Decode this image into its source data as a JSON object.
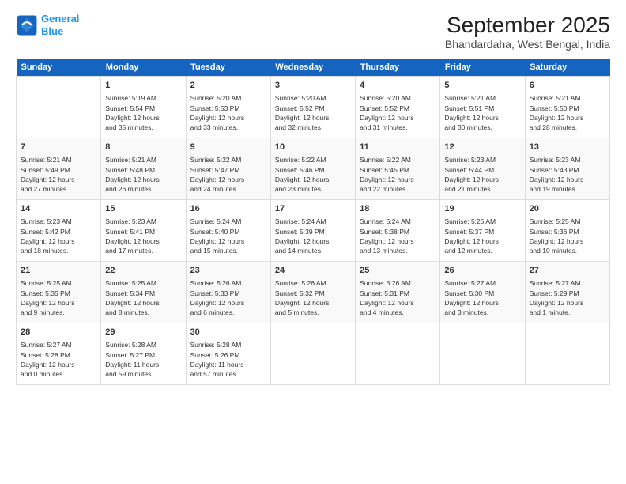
{
  "logo": {
    "line1": "General",
    "line2": "Blue"
  },
  "title": "September 2025",
  "subtitle": "Bhandardaha, West Bengal, India",
  "days_header": [
    "Sunday",
    "Monday",
    "Tuesday",
    "Wednesday",
    "Thursday",
    "Friday",
    "Saturday"
  ],
  "weeks": [
    [
      {
        "day": "",
        "text": ""
      },
      {
        "day": "1",
        "text": "Sunrise: 5:19 AM\nSunset: 5:54 PM\nDaylight: 12 hours\nand 35 minutes."
      },
      {
        "day": "2",
        "text": "Sunrise: 5:20 AM\nSunset: 5:53 PM\nDaylight: 12 hours\nand 33 minutes."
      },
      {
        "day": "3",
        "text": "Sunrise: 5:20 AM\nSunset: 5:52 PM\nDaylight: 12 hours\nand 32 minutes."
      },
      {
        "day": "4",
        "text": "Sunrise: 5:20 AM\nSunset: 5:52 PM\nDaylight: 12 hours\nand 31 minutes."
      },
      {
        "day": "5",
        "text": "Sunrise: 5:21 AM\nSunset: 5:51 PM\nDaylight: 12 hours\nand 30 minutes."
      },
      {
        "day": "6",
        "text": "Sunrise: 5:21 AM\nSunset: 5:50 PM\nDaylight: 12 hours\nand 28 minutes."
      }
    ],
    [
      {
        "day": "7",
        "text": "Sunrise: 5:21 AM\nSunset: 5:49 PM\nDaylight: 12 hours\nand 27 minutes."
      },
      {
        "day": "8",
        "text": "Sunrise: 5:21 AM\nSunset: 5:48 PM\nDaylight: 12 hours\nand 26 minutes."
      },
      {
        "day": "9",
        "text": "Sunrise: 5:22 AM\nSunset: 5:47 PM\nDaylight: 12 hours\nand 24 minutes."
      },
      {
        "day": "10",
        "text": "Sunrise: 5:22 AM\nSunset: 5:46 PM\nDaylight: 12 hours\nand 23 minutes."
      },
      {
        "day": "11",
        "text": "Sunrise: 5:22 AM\nSunset: 5:45 PM\nDaylight: 12 hours\nand 22 minutes."
      },
      {
        "day": "12",
        "text": "Sunrise: 5:23 AM\nSunset: 5:44 PM\nDaylight: 12 hours\nand 21 minutes."
      },
      {
        "day": "13",
        "text": "Sunrise: 5:23 AM\nSunset: 5:43 PM\nDaylight: 12 hours\nand 19 minutes."
      }
    ],
    [
      {
        "day": "14",
        "text": "Sunrise: 5:23 AM\nSunset: 5:42 PM\nDaylight: 12 hours\nand 18 minutes."
      },
      {
        "day": "15",
        "text": "Sunrise: 5:23 AM\nSunset: 5:41 PM\nDaylight: 12 hours\nand 17 minutes."
      },
      {
        "day": "16",
        "text": "Sunrise: 5:24 AM\nSunset: 5:40 PM\nDaylight: 12 hours\nand 15 minutes."
      },
      {
        "day": "17",
        "text": "Sunrise: 5:24 AM\nSunset: 5:39 PM\nDaylight: 12 hours\nand 14 minutes."
      },
      {
        "day": "18",
        "text": "Sunrise: 5:24 AM\nSunset: 5:38 PM\nDaylight: 12 hours\nand 13 minutes."
      },
      {
        "day": "19",
        "text": "Sunrise: 5:25 AM\nSunset: 5:37 PM\nDaylight: 12 hours\nand 12 minutes."
      },
      {
        "day": "20",
        "text": "Sunrise: 5:25 AM\nSunset: 5:36 PM\nDaylight: 12 hours\nand 10 minutes."
      }
    ],
    [
      {
        "day": "21",
        "text": "Sunrise: 5:25 AM\nSunset: 5:35 PM\nDaylight: 12 hours\nand 9 minutes."
      },
      {
        "day": "22",
        "text": "Sunrise: 5:25 AM\nSunset: 5:34 PM\nDaylight: 12 hours\nand 8 minutes."
      },
      {
        "day": "23",
        "text": "Sunrise: 5:26 AM\nSunset: 5:33 PM\nDaylight: 12 hours\nand 6 minutes."
      },
      {
        "day": "24",
        "text": "Sunrise: 5:26 AM\nSunset: 5:32 PM\nDaylight: 12 hours\nand 5 minutes."
      },
      {
        "day": "25",
        "text": "Sunrise: 5:26 AM\nSunset: 5:31 PM\nDaylight: 12 hours\nand 4 minutes."
      },
      {
        "day": "26",
        "text": "Sunrise: 5:27 AM\nSunset: 5:30 PM\nDaylight: 12 hours\nand 3 minutes."
      },
      {
        "day": "27",
        "text": "Sunrise: 5:27 AM\nSunset: 5:29 PM\nDaylight: 12 hours\nand 1 minute."
      }
    ],
    [
      {
        "day": "28",
        "text": "Sunrise: 5:27 AM\nSunset: 5:28 PM\nDaylight: 12 hours\nand 0 minutes."
      },
      {
        "day": "29",
        "text": "Sunrise: 5:28 AM\nSunset: 5:27 PM\nDaylight: 11 hours\nand 59 minutes."
      },
      {
        "day": "30",
        "text": "Sunrise: 5:28 AM\nSunset: 5:26 PM\nDaylight: 11 hours\nand 57 minutes."
      },
      {
        "day": "",
        "text": ""
      },
      {
        "day": "",
        "text": ""
      },
      {
        "day": "",
        "text": ""
      },
      {
        "day": "",
        "text": ""
      }
    ]
  ]
}
